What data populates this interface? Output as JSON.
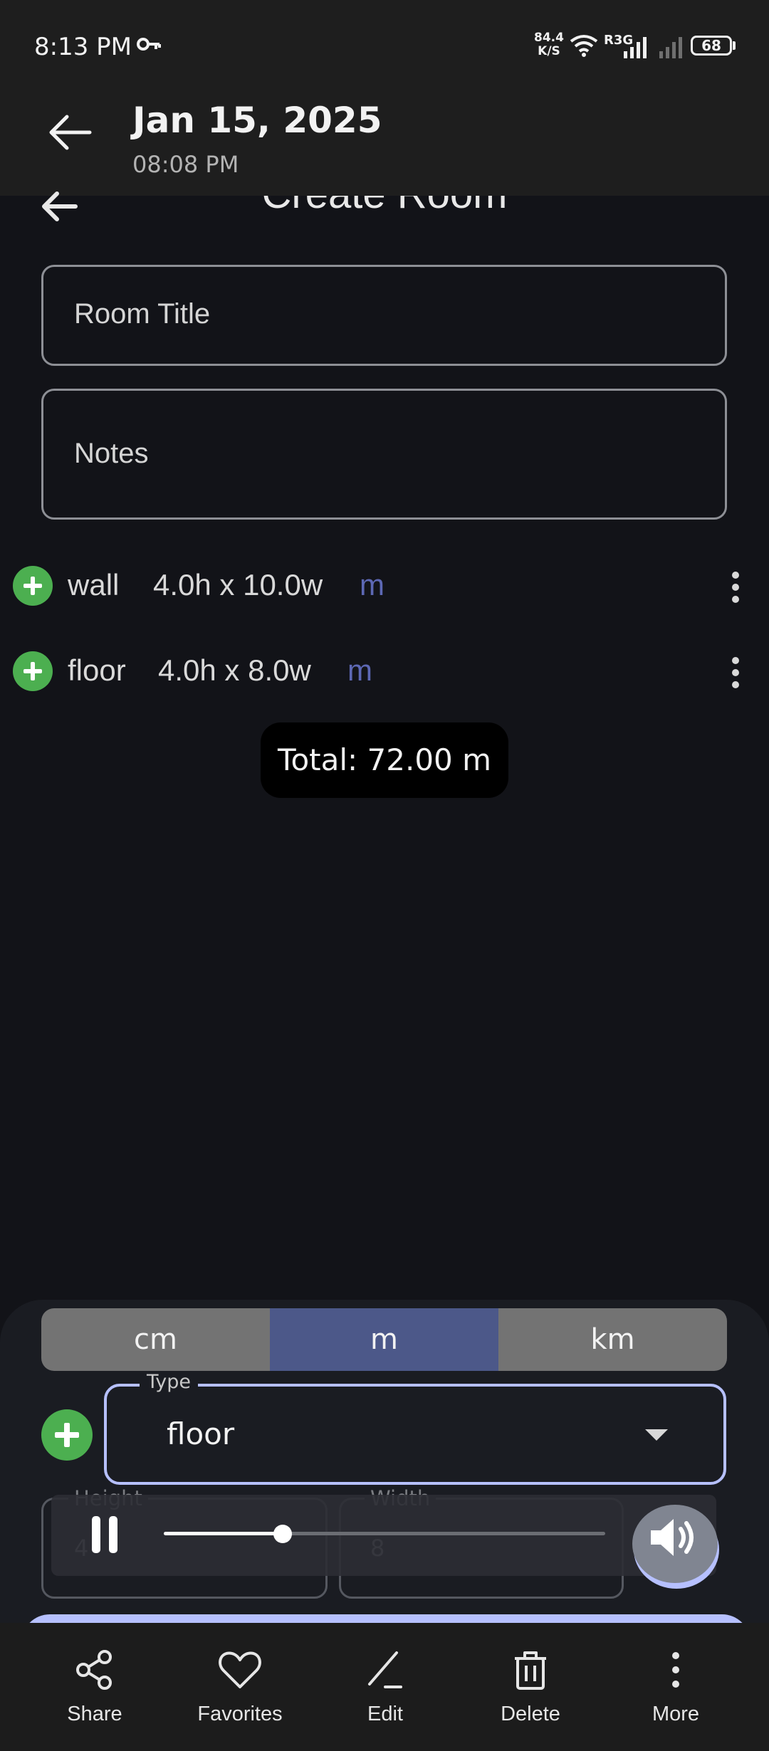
{
  "status_bar": {
    "time": "8:13 PM",
    "net_speed_value": "84.4",
    "net_speed_unit": "K/S",
    "network_label": "R3G",
    "battery": "68"
  },
  "viewer_header": {
    "date": "Jan 15, 2025",
    "time": "08:08 PM"
  },
  "app": {
    "title": "Create Room",
    "room_title_placeholder": "Room Title",
    "notes_placeholder": "Notes",
    "items": [
      {
        "name": "wall",
        "dims": "4.0h x 10.0w",
        "unit": "m"
      },
      {
        "name": "floor",
        "dims": "4.0h x 8.0w",
        "unit": "m"
      }
    ],
    "total": "Total: 72.00 m"
  },
  "sheet": {
    "units": [
      "cm",
      "m",
      "km"
    ],
    "selected_unit": "m",
    "type_label": "Type",
    "type_value": "floor",
    "height_label": "Height",
    "height_value": "4",
    "width_label": "Width",
    "width_value": "8"
  },
  "player": {
    "progress": 0.27
  },
  "toolbar": {
    "items": [
      {
        "label": "Share",
        "icon": "share-icon"
      },
      {
        "label": "Favorites",
        "icon": "heart-icon"
      },
      {
        "label": "Edit",
        "icon": "edit-icon"
      },
      {
        "label": "Delete",
        "icon": "delete-icon"
      },
      {
        "label": "More",
        "icon": "more-vert-icon"
      }
    ]
  },
  "colors": {
    "background": "#121318",
    "accent": "#b6c0ff",
    "add_green": "#4caf50",
    "unit_blue": "#5d68b4",
    "selected_segment": "#4c5889"
  }
}
